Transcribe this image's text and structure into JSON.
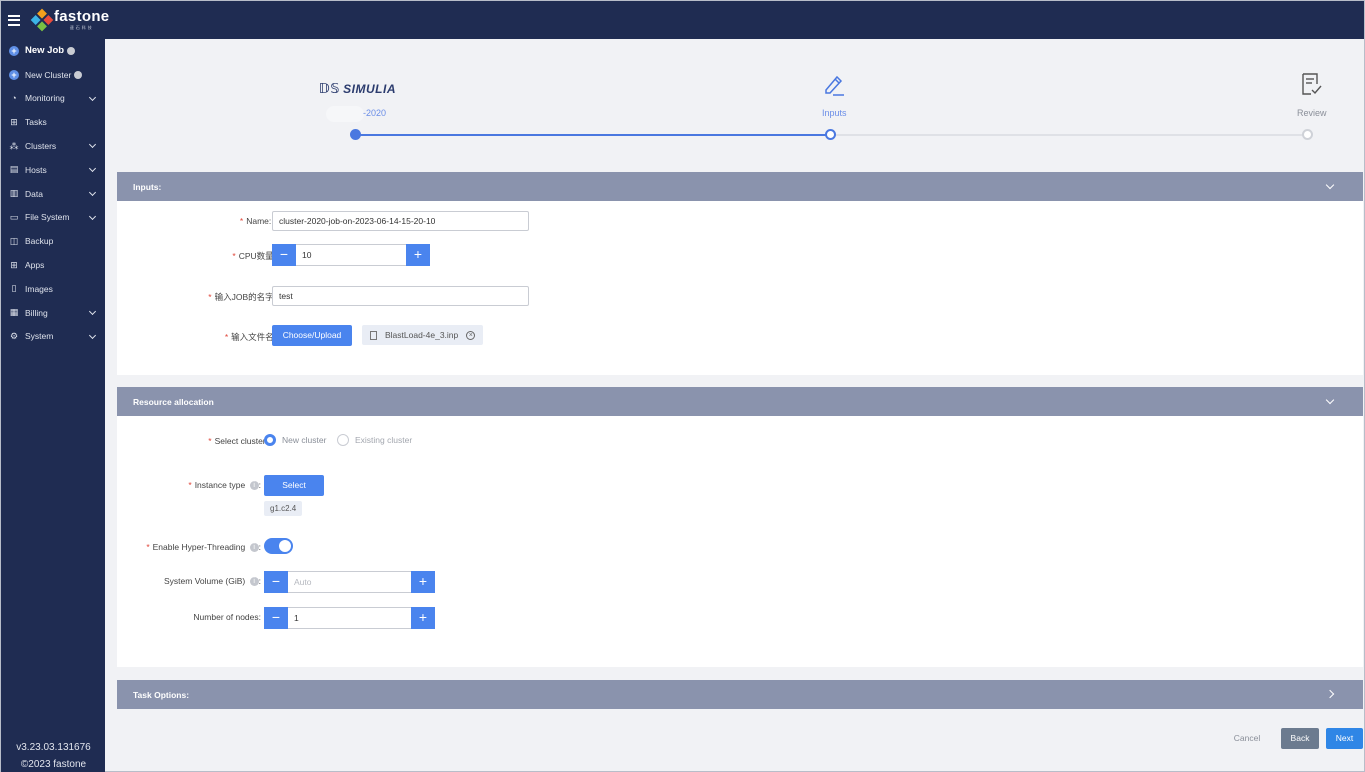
{
  "app": {
    "logo_name": "fastone",
    "logo_sub": "速石科技"
  },
  "sidebar": {
    "items": [
      {
        "label": "New Job",
        "icon": "plus-circle-icon",
        "info": true
      },
      {
        "label": "New Cluster",
        "icon": "plus-circle-icon",
        "info": true
      },
      {
        "label": "Monitoring",
        "icon": "gauge-icon",
        "expand": true
      },
      {
        "label": "Tasks",
        "icon": "grid-icon"
      },
      {
        "label": "Clusters",
        "icon": "cluster-icon",
        "expand": true
      },
      {
        "label": "Hosts",
        "icon": "server-icon",
        "expand": true
      },
      {
        "label": "Data",
        "icon": "bar-chart-icon",
        "expand": true
      },
      {
        "label": "File System",
        "icon": "folder-icon",
        "expand": true
      },
      {
        "label": "Backup",
        "icon": "backup-icon"
      },
      {
        "label": "Apps",
        "icon": "apps-icon"
      },
      {
        "label": "Images",
        "icon": "images-icon"
      },
      {
        "label": "Billing",
        "icon": "billing-icon",
        "expand": true
      },
      {
        "label": "System",
        "icon": "settings-icon",
        "expand": true
      }
    ],
    "version": "v3.23.03.131676",
    "copyright": "©2023 fastone"
  },
  "stepper": {
    "brand": "SIMULIA",
    "steps": [
      {
        "label": "-2020",
        "state": "done"
      },
      {
        "label": "Inputs",
        "state": "current"
      },
      {
        "label": "Review",
        "state": "todo"
      }
    ]
  },
  "inputs": {
    "header": "Inputs:",
    "name_label": "Name: :",
    "name_value": "cluster-2020-job-on-2023-06-14-15-20-10",
    "cpu_label": "CPU数量:",
    "cpu_value": "10",
    "jobname_label": "输入JOB的名字:",
    "jobname_value": "test",
    "file_label": "输入文件名:",
    "upload_button": "Choose/Upload",
    "file_name": "BlastLoad-4e_3.inp"
  },
  "resource": {
    "header": "Resource allocation",
    "cluster_label": "Select cluster:",
    "new_cluster": "New cluster",
    "existing_cluster": "Existing cluster",
    "instance_label": "Instance type",
    "select_button": "Select",
    "instance_value": "g1.c2.4",
    "hyper_label": "Enable Hyper-Threading",
    "hyper_on": true,
    "volume_label": "System Volume (GiB)",
    "volume_placeholder": "Auto",
    "nodes_label": "Number of nodes:",
    "nodes_value": "1"
  },
  "task_options": {
    "header": "Task Options:"
  },
  "footer": {
    "cancel": "Cancel",
    "back": "Back",
    "next": "Next"
  }
}
